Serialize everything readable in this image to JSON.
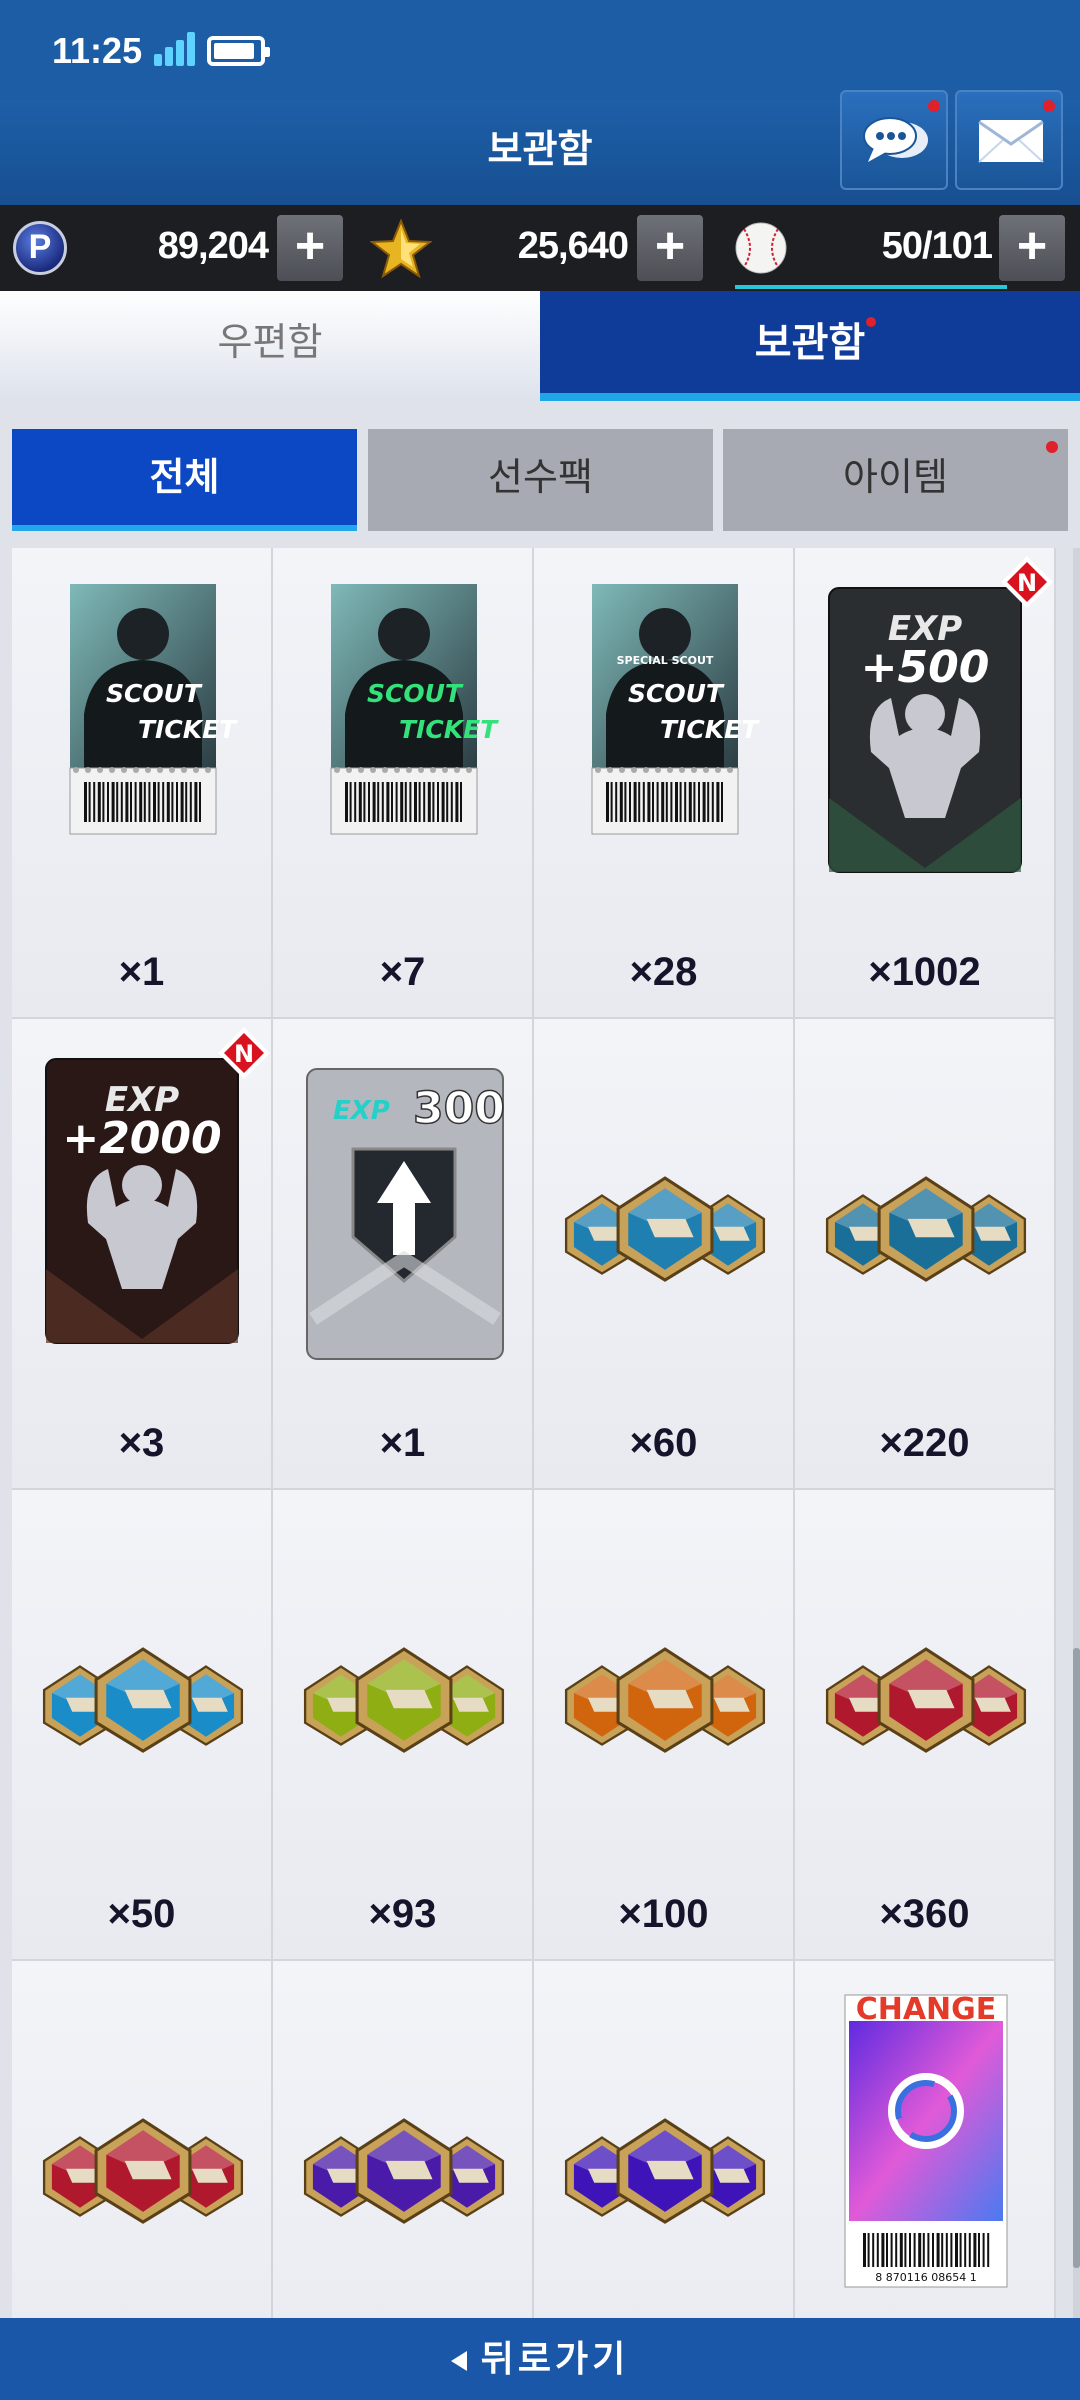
{
  "status_bar": {
    "time": "11:25"
  },
  "header": {
    "title": "보관함"
  },
  "currencies": [
    {
      "icon": "p-coin-icon",
      "value": "89,204"
    },
    {
      "icon": "gold-star-icon",
      "value": "25,640"
    },
    {
      "icon": "baseball-icon",
      "value": "50/101"
    }
  ],
  "tabs": [
    {
      "label": "우편함",
      "active": false
    },
    {
      "label": "보관함",
      "active": true,
      "has_badge": true
    }
  ],
  "filters": [
    {
      "label": "전체",
      "active": true
    },
    {
      "label": "선수팩",
      "active": false
    },
    {
      "label": "아이템",
      "active": false,
      "has_badge": true
    }
  ],
  "items": [
    {
      "kind": "scout-ticket",
      "label": "SCOUT TICKET",
      "count": "×1"
    },
    {
      "kind": "scout-ticket-gold",
      "label": "SCOUT TICKET",
      "count": "×7"
    },
    {
      "kind": "special-scout-ticket",
      "label": "SPECIAL SCOUT SCOUT TICKET",
      "count": "×28"
    },
    {
      "kind": "exp-card",
      "label": "EXP +500",
      "badge": "N",
      "count": "×1002"
    },
    {
      "kind": "exp-card",
      "label": "EXP +2000",
      "badge": "N",
      "count": "×3"
    },
    {
      "kind": "exp-upgrade",
      "label": "EXP 300",
      "count": "×1"
    },
    {
      "kind": "gems",
      "color": "#1f7fb0",
      "count": "×60"
    },
    {
      "kind": "gems",
      "color": "#1a6f98",
      "count": "×220"
    },
    {
      "kind": "gems",
      "color": "#1a8cc8",
      "count": "×50"
    },
    {
      "kind": "gems",
      "color": "#8fae14",
      "count": "×93"
    },
    {
      "kind": "gems",
      "color": "#d0650e",
      "count": "×100"
    },
    {
      "kind": "gems",
      "color": "#b0182e",
      "count": "×360"
    },
    {
      "kind": "gems",
      "color": "#b0182e",
      "count": ""
    },
    {
      "kind": "gems",
      "color": "#4a1aa8",
      "count": ""
    },
    {
      "kind": "gems",
      "color": "#3e14b8",
      "count": ""
    },
    {
      "kind": "change-ticket",
      "label": "CHANGE",
      "barcode": "8 870116 08654 1",
      "count": ""
    }
  ],
  "footer": {
    "back_label": "뒤로가기"
  }
}
